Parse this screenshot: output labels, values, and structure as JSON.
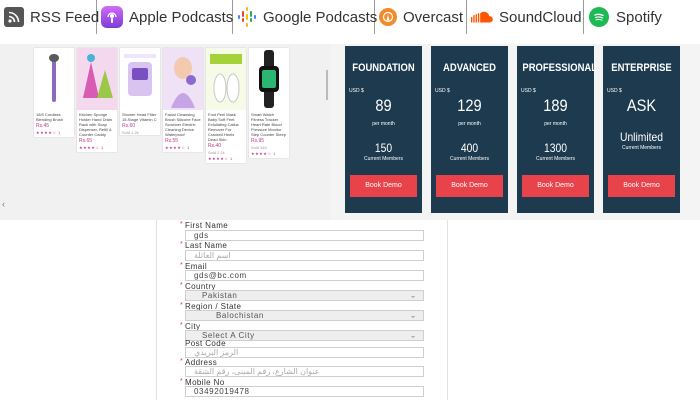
{
  "podcasts": [
    {
      "label": "RSS Feed",
      "icon": "rss-icon"
    },
    {
      "label": "Apple Podcasts",
      "icon": "apple-podcasts-icon"
    },
    {
      "label": "Google Podcasts",
      "icon": "google-podcasts-icon"
    },
    {
      "label": "Overcast",
      "icon": "overcast-icon"
    },
    {
      "label": "SoundCloud",
      "icon": "soundcloud-icon"
    },
    {
      "label": "Spotify",
      "icon": "spotify-icon"
    }
  ],
  "products": [
    {
      "title": "18/5 Cordless Blending Brush",
      "price": "Rs.45",
      "meta": "",
      "stars": "★★★★☆ 1"
    },
    {
      "title": "Kitchen Sponge Holder Hand Drain Rack with Soap Dispenser, Refill & Counter Caddy",
      "price": "Rs.65",
      "meta": "",
      "stars": "★★★★☆ 1"
    },
    {
      "title": "Shower Head Filter 15-Stage Vitamin C",
      "price": "Rs.60",
      "meta": "Sold 1.2k",
      "stars": "★★★★☆ 1"
    },
    {
      "title": "Facial Cleansing Brush Silicone Face Scrubber Electric Cleaning Device Waterproof",
      "price": "Rs.55",
      "meta": "",
      "stars": "★★★★☆ 1"
    },
    {
      "title": "Foot Peel Mask Baby Soft Feet Exfoliating Callus Remover For Cracked Heels Dead Skin",
      "price": "Rs.40",
      "meta": "Sold 2.1k",
      "stars": "★★★★☆ 1"
    },
    {
      "title": "Smart Watch Fitness Tracker Heart Rate Blood Pressure Monitor Step Counter Sleep",
      "price": "Rs.95",
      "meta": "Sold 340",
      "stars": "★★★★☆ 1"
    }
  ],
  "plans": [
    {
      "name": "FOUNDATION",
      "currency": "USD $",
      "price": "89",
      "period": "per month",
      "members": "150",
      "members_label": "Current Members",
      "button": "Book Demo"
    },
    {
      "name": "ADVANCED",
      "currency": "USD $",
      "price": "129",
      "period": "per month",
      "members": "400",
      "members_label": "Current Members",
      "button": "Book Demo"
    },
    {
      "name": "PROFESSIONAL",
      "currency": "USD $",
      "price": "189",
      "period": "per month",
      "members": "1300",
      "members_label": "Current Members",
      "button": "Book Demo"
    },
    {
      "name": "ENTERPRISE",
      "currency": "USD $",
      "price": "ASK",
      "period": "",
      "members": "Unlimited",
      "members_label": "Current Members",
      "button": "Book Demo"
    }
  ],
  "form": {
    "first_name": {
      "label": "First Name",
      "value": "gds"
    },
    "last_name": {
      "label": "Last Name",
      "placeholder": "اسم العائلة"
    },
    "email": {
      "label": "Email",
      "value": "gds@bc.com"
    },
    "country": {
      "label": "Country",
      "value": "Pakistan"
    },
    "region": {
      "label": "Region / State",
      "value": "Balochistan"
    },
    "city": {
      "label": "City",
      "value": "Select A City"
    },
    "post_code": {
      "label": "Post Code",
      "placeholder": "الرمز البريدي"
    },
    "address": {
      "label": "Address",
      "placeholder": "عنوان الشارع، رقم المبنى، رقم الشقة"
    },
    "mobile": {
      "label": "Mobile No",
      "value": "03492019478"
    }
  },
  "colors": {
    "plan_bg": "#1d3a4f",
    "plan_button": "#e8434b",
    "price_accent": "#c0398b",
    "required_star": "#e53935"
  }
}
